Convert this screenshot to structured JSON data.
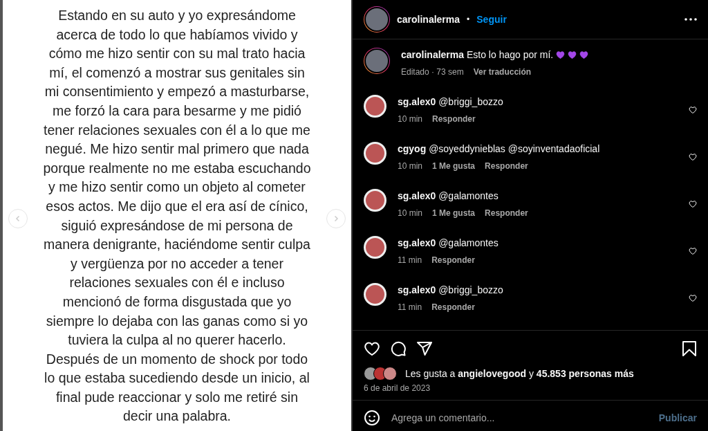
{
  "post_image": {
    "lines": [
      "Estando en su auto y yo expresándome",
      "acerca de todo lo que habíamos vivido y",
      "cómo me hizo sentir con su mal trato hacia",
      "mí, el comenzó a mostrar sus genitales sin",
      "mi consentimiento y empezó a masturbarse,",
      "me forzó la cara para besarme y me pidió",
      "tener relaciones sexuales con él a lo que me",
      "negué. Me hizo sentir mal primero que nada",
      "porque realmente no me estaba escuchando",
      "y me hizo sentir como un objeto al cometer",
      "esos actos. Me dijo que el era así de cínico,",
      "siguió expresándose de mi persona de",
      "manera denigrante, haciéndome sentir culpa",
      "y vergüenza por no acceder a tener",
      "relaciones sexuales con él e incluso",
      "mencionó de forma disgustada que yo",
      "siempre lo dejaba con las ganas como si yo",
      "tuviera la culpa al no querer hacerlo.",
      "Después de un momento de shock por todo",
      "lo que estaba sucediendo desde un inicio, al",
      "final pude reaccionar y solo me retiré sin",
      "decir una palabra."
    ]
  },
  "header": {
    "username": "carolinalerma",
    "separator": "•",
    "follow": "Seguir"
  },
  "caption": {
    "username": "carolinalerma",
    "text": "Esto lo hago por mí.",
    "meta": "Editado · 73 sem",
    "translate": "Ver traducción"
  },
  "comments": [
    {
      "username": "sg.alex0",
      "text": "@briggi_bozzo",
      "time": "10 min",
      "reply": "Responder"
    },
    {
      "username": "cgyog",
      "text": "@soyeddynieblas @soyinventadaoficial",
      "time": "10 min",
      "likes": "1 Me gusta",
      "reply": "Responder"
    },
    {
      "username": "sg.alex0",
      "text": "@galamontes",
      "time": "10 min",
      "likes": "1 Me gusta",
      "reply": "Responder"
    },
    {
      "username": "sg.alex0",
      "text": "@galamontes",
      "time": "11 min",
      "reply": "Responder"
    },
    {
      "username": "sg.alex0",
      "text": "@briggi_bozzo",
      "time": "11 min",
      "reply": "Responder"
    }
  ],
  "likes": {
    "text": "Les gusta a **angielovegood** y **45.853 personas más**"
  },
  "date": "6 de abril de 2023",
  "comment_field": {
    "placeholder": "Agrega un comentario...",
    "button": "Publicar"
  }
}
